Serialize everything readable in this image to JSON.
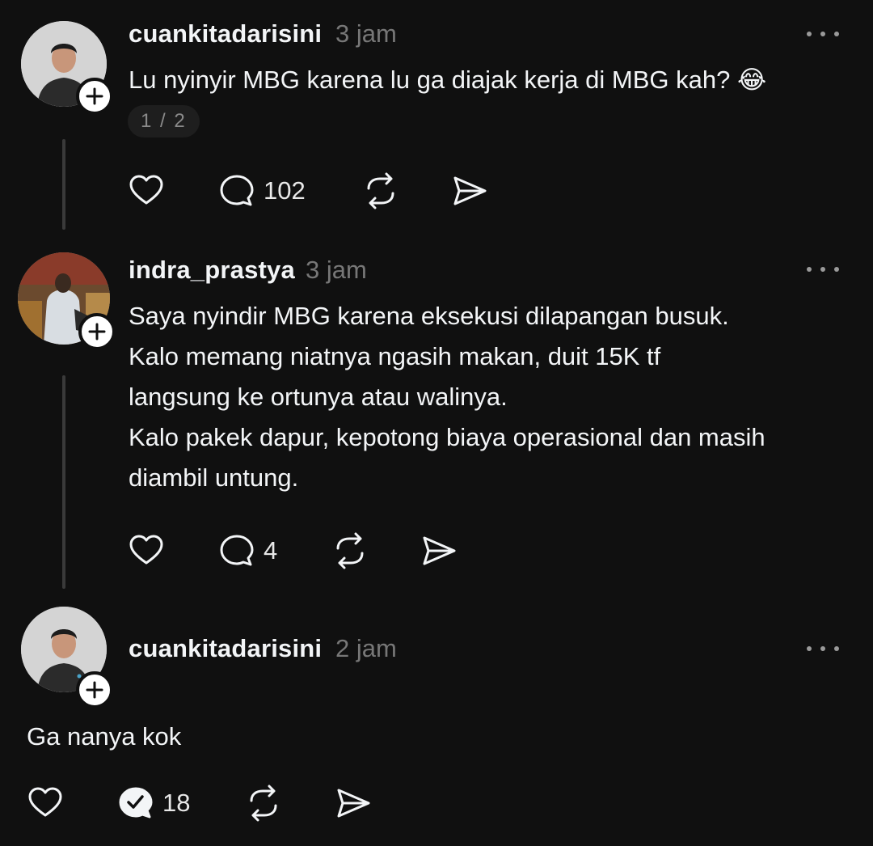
{
  "posts": [
    {
      "username": "cuankitadarisini",
      "time": "3 jam",
      "text_lines": [
        "Lu nyinyir MBG karena lu ga diajak kerja di MBG kah? 😂"
      ],
      "pager": "1 / 2",
      "reply_count": "102"
    },
    {
      "username": "indra_prastya",
      "time": "3 jam",
      "text_lines": [
        "Saya nyindir MBG karena eksekusi dilapangan busuk.",
        "Kalo memang niatnya ngasih makan, duit 15K tf",
        "langsung ke ortunya atau walinya.",
        "Kalo pakek dapur, kepotong biaya operasional dan masih",
        "diambil untung."
      ],
      "reply_count": "4"
    },
    {
      "username": "cuankitadarisini",
      "time": "2 jam",
      "text_lines": [
        "Ga nanya kok"
      ],
      "reply_count": "18"
    }
  ],
  "icons": {
    "like": "heart-icon",
    "reply": "speech-bubble-icon",
    "reply_done": "speech-bubble-check-icon",
    "repost": "repost-icon",
    "share": "send-icon",
    "more": "more-dots-icon",
    "follow": "plus-icon"
  },
  "colors": {
    "background": "#101010",
    "text": "#f3f5f7",
    "muted": "#777777",
    "thread_line": "#3a3a3a"
  }
}
